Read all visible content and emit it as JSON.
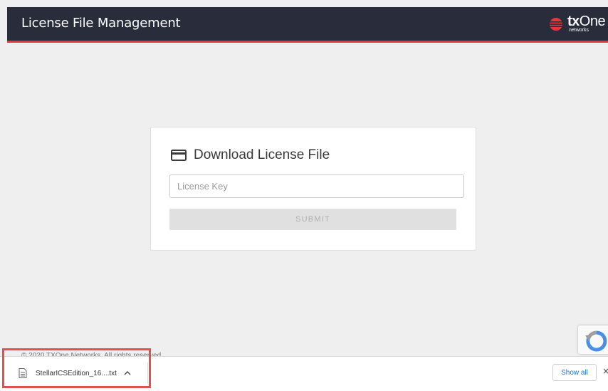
{
  "header": {
    "title": "License File Management",
    "logo": {
      "word_bold": "tx",
      "word_rest": "One",
      "subtitle": "networks",
      "accent": "#e8363e"
    }
  },
  "card": {
    "title": "Download License File",
    "icon": "credit-card-icon",
    "license_input": {
      "placeholder": "License Key",
      "value": ""
    },
    "submit_label": "SUBMIT"
  },
  "footer": {
    "text": "© 2020 TXOne Networks. All rights reserved."
  },
  "download_bar": {
    "file_name": "StellarICSEdition_16....txt",
    "file_icon": "document-icon",
    "expand_icon": "chevron-up-icon",
    "show_all_label": "Show all",
    "close_glyph": "×"
  },
  "colors": {
    "header_bg": "#282c3b",
    "accent_red": "#e8363e",
    "page_bg": "#efefef",
    "link_blue": "#1a73e8"
  }
}
